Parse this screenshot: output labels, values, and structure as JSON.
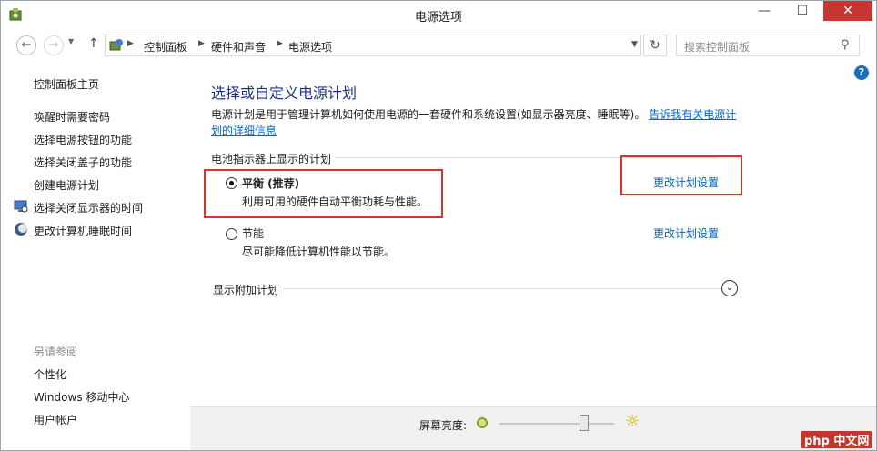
{
  "window": {
    "title": "电源选项",
    "minimize": "—",
    "maximize": "☐",
    "close": "✕"
  },
  "address": {
    "breadcrumbs": [
      "控制面板",
      "硬件和声音",
      "电源选项"
    ],
    "search_placeholder": "搜索控制面板"
  },
  "sidebar": {
    "home": "控制面板主页",
    "links": [
      "唤醒时需要密码",
      "选择电源按钮的功能",
      "选择关闭盖子的功能",
      "创建电源计划",
      "选择关闭显示器的时间",
      "更改计算机睡眠时间"
    ],
    "see_also_heading": "另请参阅",
    "see_also": [
      "个性化",
      "Windows 移动中心",
      "用户帐户"
    ]
  },
  "main": {
    "title": "选择或自定义电源计划",
    "intro": "电源计划是用于管理计算机如何使用电源的一套硬件和系统设置(如显示器亮度、睡眠等)。",
    "intro_link": "告诉我有关电源计划的详细信息",
    "group_heading": "电池指示器上显示的计划",
    "plans": [
      {
        "name": "平衡 (推荐)",
        "desc": "利用可用的硬件自动平衡功耗与性能。",
        "link": "更改计划设置",
        "selected": true
      },
      {
        "name": "节能",
        "desc": "尽可能降低计算机性能以节能。",
        "link": "更改计划设置",
        "selected": false
      }
    ],
    "more_plans": "显示附加计划"
  },
  "bottom": {
    "brightness_label": "屏幕亮度:",
    "brightness_level": 0.74
  },
  "colors": {
    "title_blue": "#1e3287",
    "link_blue": "#0066cc",
    "highlight_red": "#d9342b",
    "close_red": "#c7372f"
  },
  "watermark": "php 中文网"
}
